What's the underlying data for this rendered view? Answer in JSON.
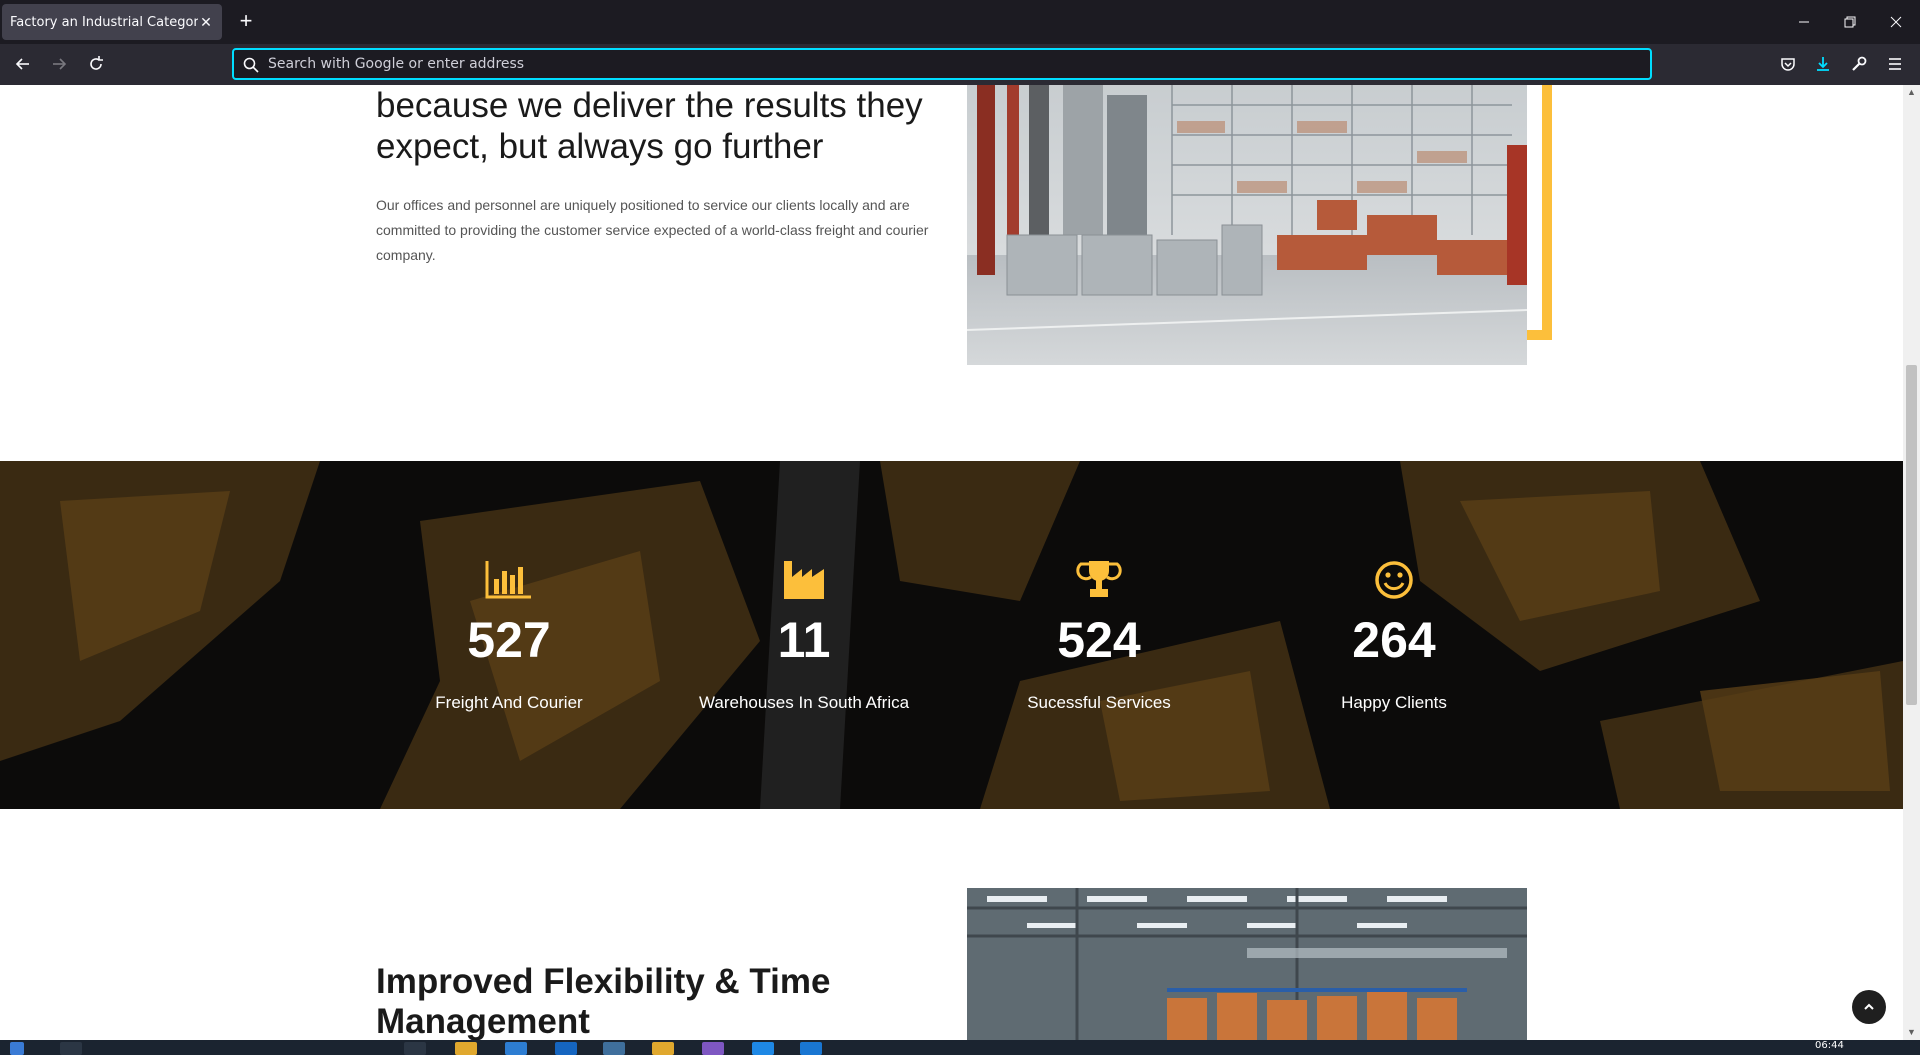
{
  "browser": {
    "tab_title": "Factory an Industrial Category Bootstrap",
    "url_placeholder": "Search with Google or enter address"
  },
  "about": {
    "heading": "because we deliver the results they expect, but always go further",
    "text": "Our offices and personnel are uniquely positioned to service our clients locally and are committed to providing the customer service expected of a world-class freight and courier company."
  },
  "stats": [
    {
      "icon": "bar-chart-icon",
      "value": "527",
      "label": "Freight And Courier"
    },
    {
      "icon": "factory-icon",
      "value": "11",
      "label": "Warehouses In South Africa"
    },
    {
      "icon": "trophy-icon",
      "value": "524",
      "label": "Sucessful Services"
    },
    {
      "icon": "smiley-icon",
      "value": "264",
      "label": "Happy Clients"
    }
  ],
  "section2": {
    "heading": "Improved Flexibility & Time Management"
  },
  "taskbar": {
    "clock": "06:44"
  },
  "colors": {
    "accent": "#fcbf3b",
    "stats_bg": "#0c0b0a",
    "chrome_bg": "#1c1b22",
    "url_focus": "#00ddff"
  }
}
